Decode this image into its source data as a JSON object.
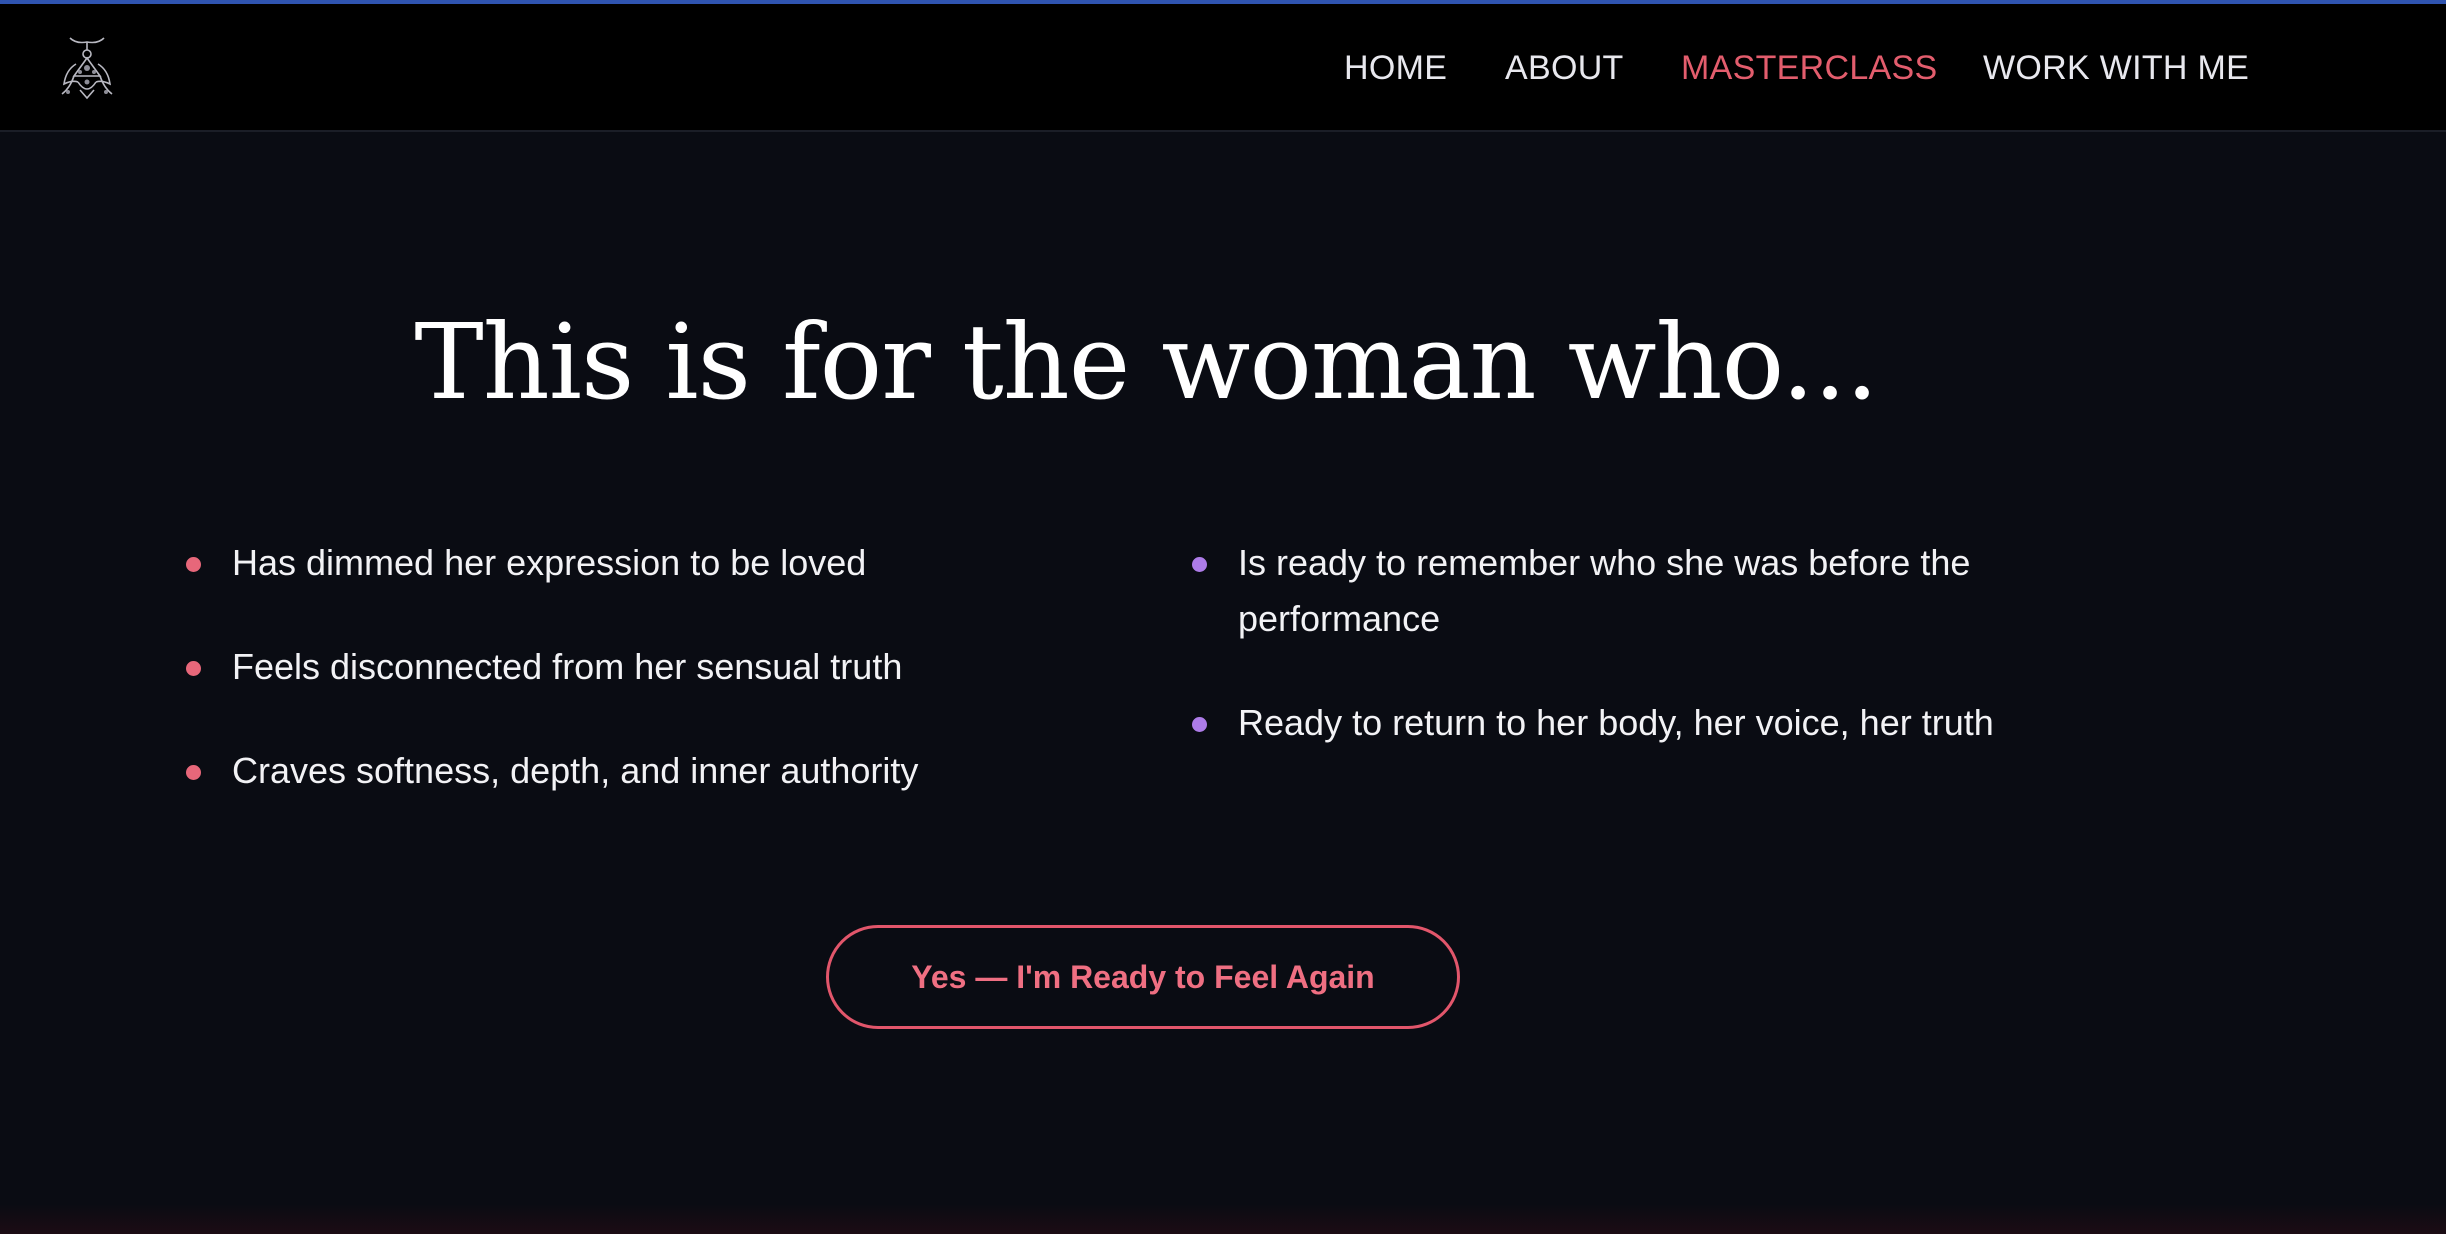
{
  "nav": {
    "logo_icon": "ornate-crest-logo-icon",
    "items": [
      {
        "label": "HOME",
        "active": false
      },
      {
        "label": "ABOUT",
        "active": false
      },
      {
        "label": "MASTERCLASS",
        "active": true
      },
      {
        "label": "WORK WITH ME",
        "active": false
      }
    ]
  },
  "section": {
    "headline": "This is for the woman who...",
    "left_items": [
      {
        "text": "Has dimmed her expression to be loved"
      },
      {
        "text": "Feels disconnected from her sensual truth"
      },
      {
        "text": "Craves softness, depth, and inner authority"
      }
    ],
    "right_items": [
      {
        "text": "Is ready to remember who she was before the performance"
      },
      {
        "text": "Ready to return to her body, her voice, her truth"
      }
    ],
    "cta_label": "Yes — I'm Ready to Feel Again"
  },
  "colors": {
    "background": "#0a0c13",
    "nav_background": "#000000",
    "accent_pink": "#e35d6d",
    "bullet_pink": "#e7677a",
    "bullet_purple": "#ad7ce8",
    "top_accent": "#2f54b0"
  }
}
